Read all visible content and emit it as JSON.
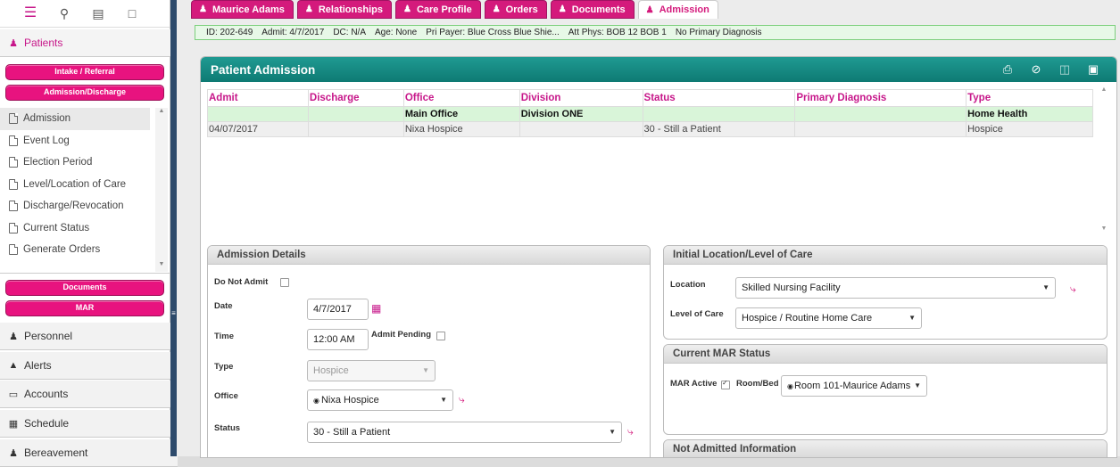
{
  "sidebar": {
    "top_icons": [
      "menu-icon",
      "search-icon",
      "id-card-icon",
      "note-icon"
    ],
    "patients_label": "Patients",
    "intake_label": "Intake / Referral",
    "admission_discharge_label": "Admission/Discharge",
    "sub_items": [
      {
        "label": "Admission"
      },
      {
        "label": "Event Log"
      },
      {
        "label": "Election Period"
      },
      {
        "label": "Level/Location of Care"
      },
      {
        "label": "Discharge/Revocation"
      },
      {
        "label": "Current Status"
      },
      {
        "label": "Generate Orders"
      }
    ],
    "documents_label": "Documents",
    "mar_label": "MAR",
    "sections": [
      {
        "label": "Personnel",
        "icon": "person-icon"
      },
      {
        "label": "Alerts",
        "icon": "warning-icon"
      },
      {
        "label": "Accounts",
        "icon": "folder-icon"
      },
      {
        "label": "Schedule",
        "icon": "calendar-icon"
      },
      {
        "label": "Bereavement",
        "icon": "person-icon"
      }
    ]
  },
  "tabs": [
    {
      "label": "Maurice Adams"
    },
    {
      "label": "Relationships"
    },
    {
      "label": "Care Profile"
    },
    {
      "label": "Orders"
    },
    {
      "label": "Documents"
    },
    {
      "label": "Admission"
    }
  ],
  "infobar": {
    "id": "ID: 202-649",
    "admit": "Admit: 4/7/2017",
    "dc": "DC: N/A",
    "age": "Age: None",
    "payer": "Pri Payer: Blue Cross Blue Shie...",
    "phys": "Att Phys: BOB 12 BOB 1",
    "diagnosis": "No Primary Diagnosis"
  },
  "panel": {
    "title": "Patient Admission",
    "tools": [
      "print-icon",
      "cancel-icon",
      "delete-icon",
      "save-icon"
    ]
  },
  "grid": {
    "headers": [
      "Admit",
      "Discharge",
      "Office",
      "Division",
      "Status",
      "Primary Diagnosis",
      "Type"
    ],
    "group_row": [
      "",
      "",
      "Main Office",
      "Division ONE",
      "",
      "",
      "Home Health"
    ],
    "data_row": [
      "04/07/2017",
      "",
      "Nixa Hospice",
      "",
      "30 - Still a Patient",
      "",
      "Hospice"
    ]
  },
  "admission_details": {
    "title": "Admission Details",
    "do_not_admit_label": "Do Not Admit",
    "date_label": "Date",
    "date_value": "4/7/2017",
    "time_label": "Time",
    "time_value": "12:00 AM",
    "admit_pending_label": "Admit Pending",
    "type_label": "Type",
    "type_value": "Hospice",
    "office_label": "Office",
    "office_value": "Nixa Hospice",
    "status_label": "Status",
    "status_value": "30 - Still a Patient"
  },
  "initial_location": {
    "title": "Initial Location/Level of Care",
    "location_label": "Location",
    "location_value": "Skilled Nursing Facility",
    "level_label": "Level of Care",
    "level_value": "Hospice / Routine Home Care"
  },
  "mar_status": {
    "title": "Current MAR Status",
    "mar_active_label": "MAR Active",
    "room_label": "Room/Bed",
    "room_value": "Room 101-Maurice Adams"
  },
  "not_admitted": {
    "title": "Not Admitted Information"
  }
}
